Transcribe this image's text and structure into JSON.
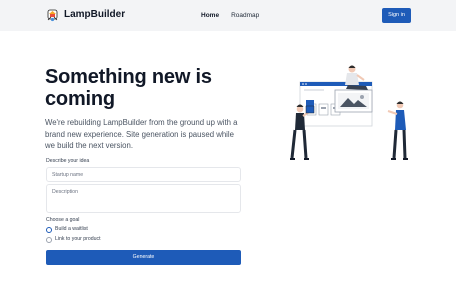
{
  "header": {
    "brand": "LampBuilder",
    "logo_icon": "lamp-icon",
    "nav": [
      {
        "label": "Home",
        "active": true
      },
      {
        "label": "Roadmap",
        "active": false
      }
    ],
    "signin_label": "Sign in"
  },
  "hero": {
    "title": "Something new is coming",
    "subtitle": "We're rebuilding LampBuilder from the ground up with a brand new experience. Site generation is paused while we build the next version."
  },
  "form": {
    "describe_label": "Describe your idea",
    "name_placeholder": "Startup name",
    "name_value": "",
    "description_placeholder": "Description",
    "description_value": "",
    "goal_label": "Choose a goal",
    "goals": [
      {
        "label": "Build a waitlist",
        "checked": true
      },
      {
        "label": "Link to your product",
        "checked": false
      }
    ],
    "generate_label": "Generate"
  },
  "colors": {
    "accent": "#1e5bb8",
    "header_bg": "#f3f4f6",
    "heading": "#111827",
    "body_text": "#4b5563"
  }
}
